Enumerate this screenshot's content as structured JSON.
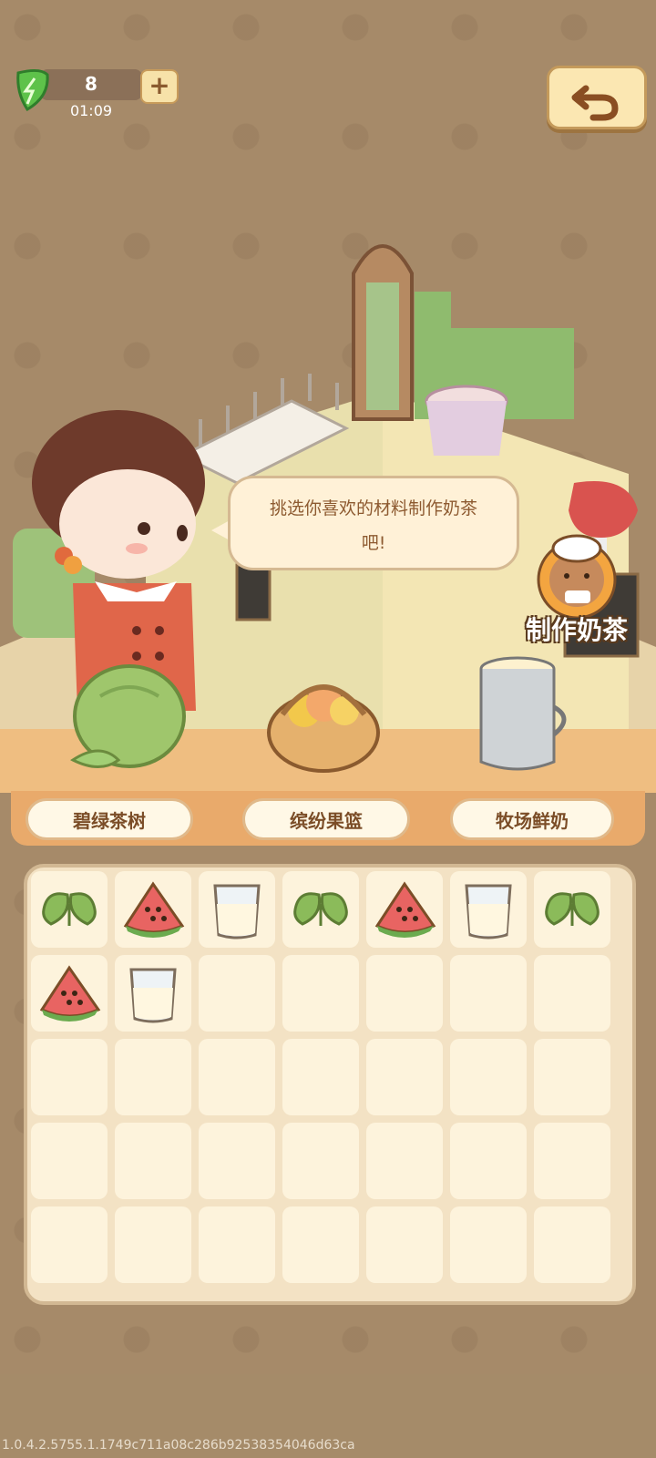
{
  "energy": {
    "count": "8",
    "timer": "01:09"
  },
  "dialogue": {
    "line1": "挑选你喜欢的材料制作奶茶",
    "line2": "吧!"
  },
  "make_tea_label": "制作奶茶",
  "categories": [
    {
      "label": "碧绿茶树",
      "icon": "tea-tree-icon"
    },
    {
      "label": "缤纷果篮",
      "icon": "fruit-basket-icon"
    },
    {
      "label": "牧场鲜奶",
      "icon": "milk-can-icon"
    }
  ],
  "inventory": {
    "columns": 7,
    "rows": 5,
    "items": [
      "leaf",
      "watermelon",
      "milk",
      "leaf",
      "watermelon",
      "milk",
      "leaf",
      "watermelon",
      "milk"
    ]
  },
  "version": "1.0.4.2.5755.1.1749c711a08c286b92538354046d63ca"
}
